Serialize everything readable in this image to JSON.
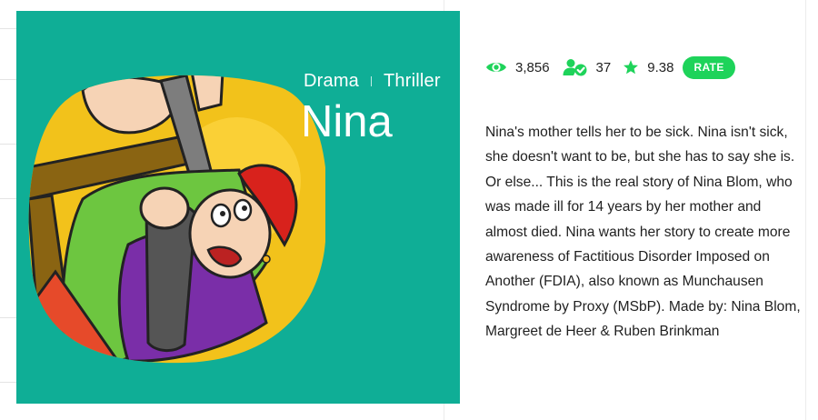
{
  "cover": {
    "genres": [
      "Drama",
      "Thriller"
    ],
    "title": "Nina",
    "background_color": "#0fae96"
  },
  "stats": {
    "views": "3,856",
    "followers": "37",
    "rating": "9.38",
    "rate_label": "RATE",
    "icons": [
      "eye-icon",
      "followers-check-icon",
      "star-icon"
    ],
    "accent_color": "#1ed35a"
  },
  "description": "Nina's mother tells her to be sick. Nina isn't sick, she doesn't want to be, but she has to say she is. Or else... This is the real story of Nina Blom, who was made ill for 14 years by her mother and almost died. Nina wants her story to create more awareness of Factitious Disorder Imposed on Another (FDIA), also known as Munchausen Syndrome by Proxy (MSbP). Made by: Nina Blom, Margreet de Heer & Ruben Brinkman"
}
